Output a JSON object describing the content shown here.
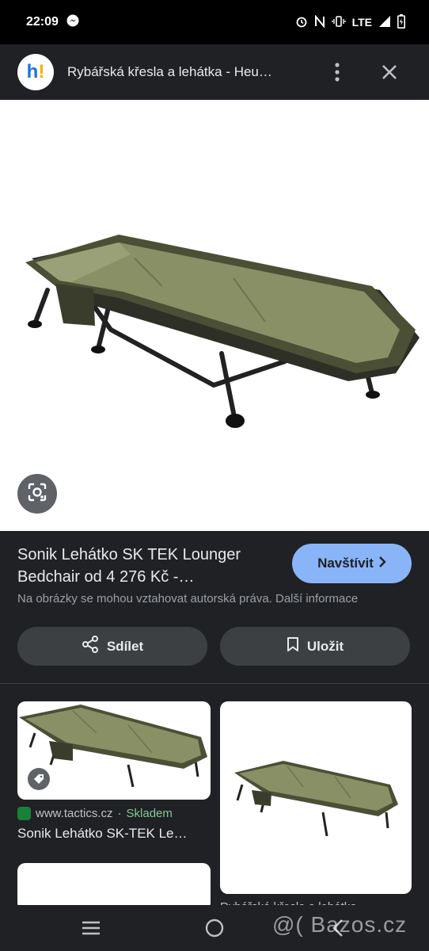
{
  "status_bar": {
    "time": "22:09",
    "network": "LTE",
    "icons": [
      "messenger-icon",
      "alarm-icon",
      "nfc-icon",
      "vibrate-icon",
      "signal-icon",
      "battery-icon"
    ]
  },
  "app_bar": {
    "site_logo_text": "h",
    "site_logo_accent": "!",
    "title": "Rybářská křesla a lehátka - Heu…",
    "icons": [
      "more-vert-icon",
      "close-icon"
    ]
  },
  "main_image": {
    "description_icon": "lens-icon"
  },
  "result": {
    "title": "Sonik Lehátko SK TEK Lounger Bedchair od 4 276 Kč -…",
    "visit_label": "Navštívit",
    "copyright_notice": "Na obrázky se mohou vztahovat autorská práva. Další informace",
    "share_label": "Sdílet",
    "save_label": "Uložit"
  },
  "related": [
    {
      "source": "www.tactics.cz",
      "separator": "·",
      "stock": "Skladem",
      "title": "Sonik Lehátko SK-TEK Le…"
    },
    {
      "caption": "Rybářská křesla a lehátka"
    }
  ],
  "watermark": "@( Bazos.cz",
  "colors": {
    "background": "#202124",
    "accent": "#8ab4f8",
    "button": "#3c4043",
    "stock_green": "#81c995"
  }
}
